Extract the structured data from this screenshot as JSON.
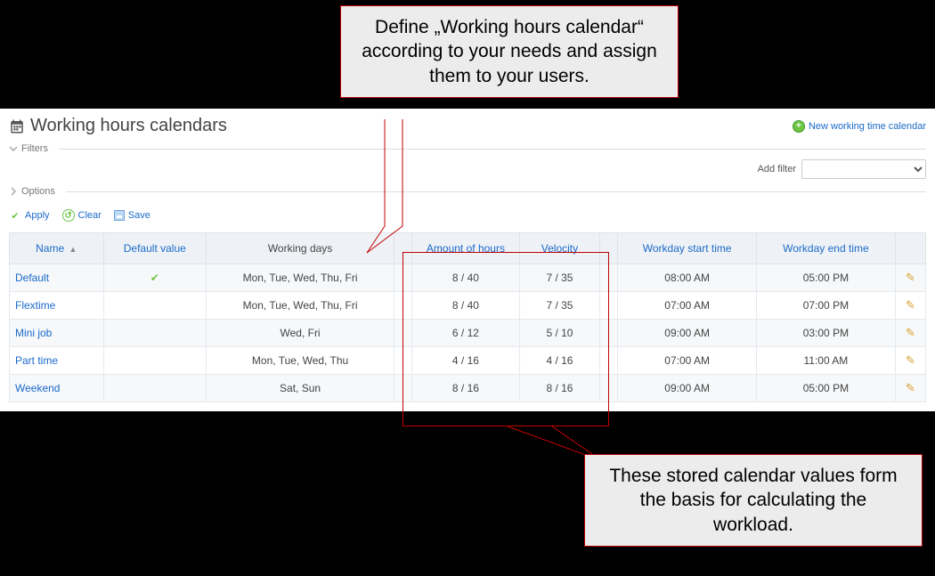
{
  "page": {
    "title": "Working hours calendars",
    "new_link": "New working time calendar"
  },
  "sections": {
    "filters_label": "Filters",
    "options_label": "Options",
    "add_filter_label": "Add filter"
  },
  "actions": {
    "apply": "Apply",
    "clear": "Clear",
    "save": "Save"
  },
  "table": {
    "headers": {
      "name": "Name",
      "default_value": "Default value",
      "working_days": "Working days",
      "amount_of_hours": "Amount of hours",
      "velocity": "Velocity",
      "workday_start": "Workday start time",
      "workday_end": "Workday end time"
    },
    "rows": [
      {
        "name": "Default",
        "is_default": true,
        "days": "Mon, Tue, Wed, Thu, Fri",
        "hours": "8 / 40",
        "velocity": "7 / 35",
        "start": "08:00 AM",
        "end": "05:00 PM"
      },
      {
        "name": "Flextime",
        "is_default": false,
        "days": "Mon, Tue, Wed, Thu, Fri",
        "hours": "8 / 40",
        "velocity": "7 / 35",
        "start": "07:00 AM",
        "end": "07:00 PM"
      },
      {
        "name": "Mini job",
        "is_default": false,
        "days": "Wed, Fri",
        "hours": "6 / 12",
        "velocity": "5 / 10",
        "start": "09:00 AM",
        "end": "03:00 PM"
      },
      {
        "name": "Part time",
        "is_default": false,
        "days": "Mon, Tue, Wed, Thu",
        "hours": "4 / 16",
        "velocity": "4 / 16",
        "start": "07:00 AM",
        "end": "11:00 AM"
      },
      {
        "name": "Weekend",
        "is_default": false,
        "days": "Sat, Sun",
        "hours": "8 / 16",
        "velocity": "8 / 16",
        "start": "09:00 AM",
        "end": "05:00 PM"
      }
    ]
  },
  "annotations": {
    "top": "Define „Working hours calendar“ according to your needs and assign them to your users.",
    "bottom": "These stored calendar values form the basis for calculating the workload."
  }
}
